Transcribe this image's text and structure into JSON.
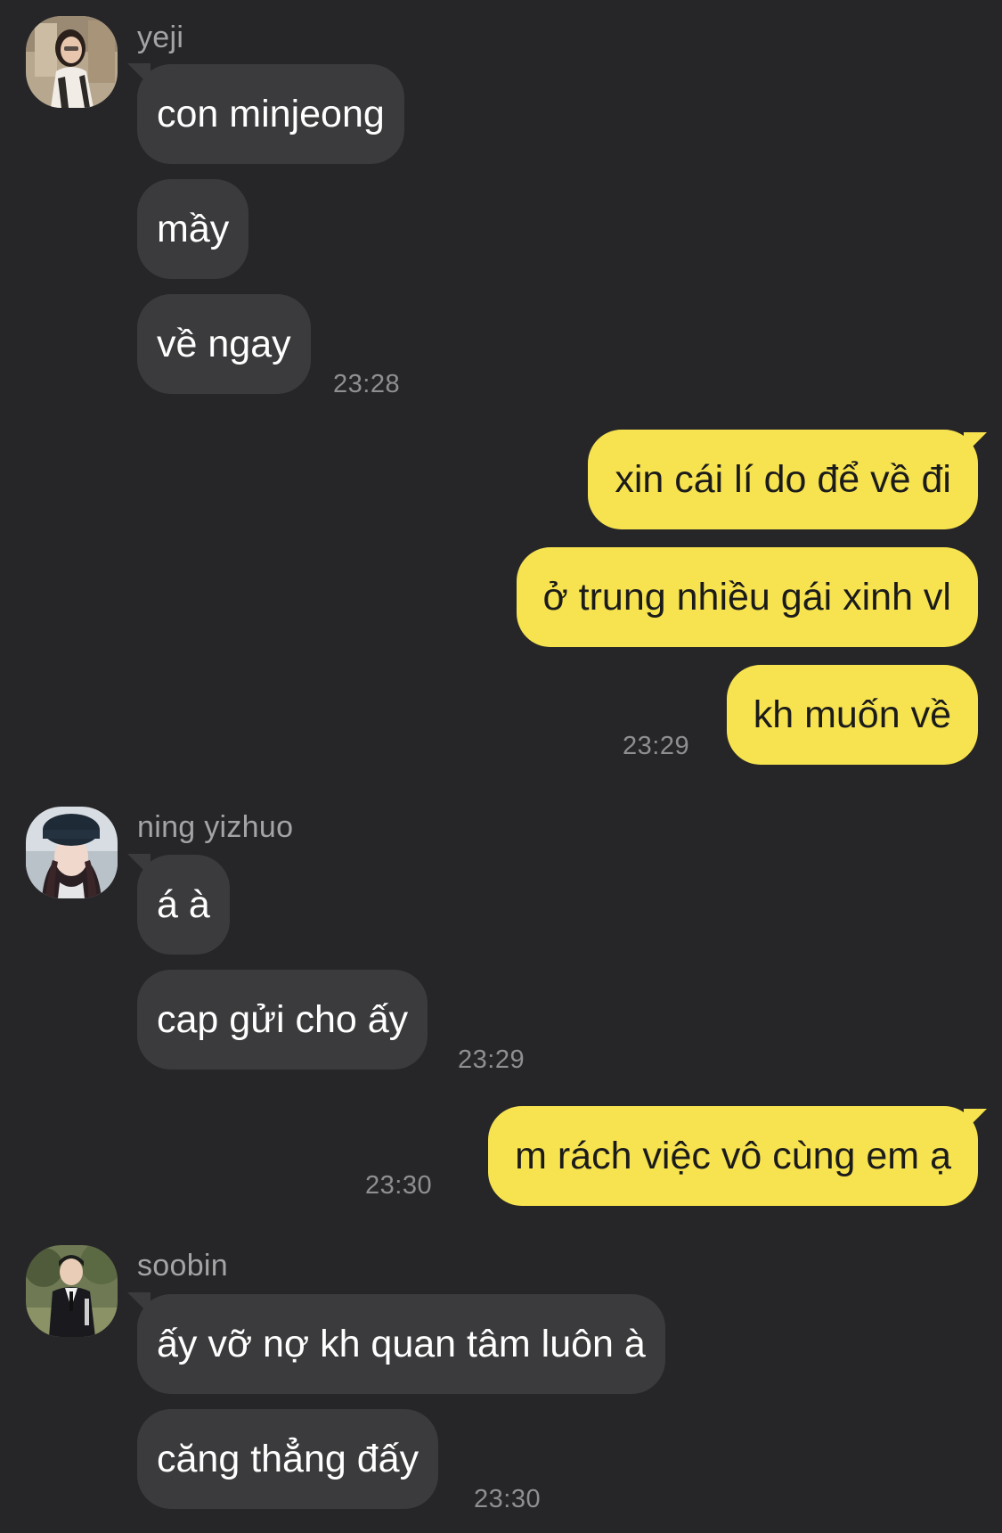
{
  "colors": {
    "background": "#262628",
    "incoming_bubble": "#3b3b3d",
    "outgoing_bubble": "#f7e34f",
    "sender_name": "#a4a4a6",
    "timestamp": "#8f8f92"
  },
  "groups": [
    {
      "sender": "yeji",
      "avatar_icon": "profile-photo-icon",
      "messages": [
        "con minjeong",
        "mầy",
        "về ngay"
      ],
      "time": "23:28"
    },
    {
      "sender": "me",
      "messages": [
        "xin cái lí do để về đi",
        "ở trung nhiều gái xinh vl",
        "kh muốn về"
      ],
      "time": "23:29"
    },
    {
      "sender": "ning yizhuo",
      "avatar_icon": "profile-photo-icon",
      "messages": [
        "á à",
        "cap gửi cho ấy"
      ],
      "time": "23:29"
    },
    {
      "sender": "me",
      "messages": [
        "m rách việc vô cùng em ạ"
      ],
      "time": "23:30"
    },
    {
      "sender": "soobin",
      "avatar_icon": "profile-photo-icon",
      "messages": [
        "ấy vỡ nợ kh quan tâm luôn à",
        "căng thẳng đấy"
      ],
      "time": "23:30"
    }
  ]
}
